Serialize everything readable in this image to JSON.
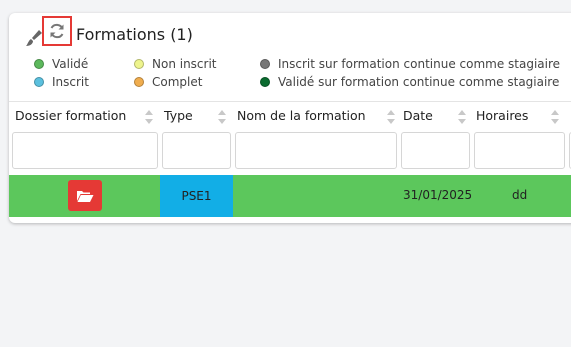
{
  "header": {
    "title": "Formations",
    "count": "(1)",
    "brush_icon": "brush-icon",
    "refresh_icon": "refresh-icon"
  },
  "legend": {
    "valide": "Validé",
    "non_inscrit": "Non inscrit",
    "inscrit_continue": "Inscrit sur formation continue comme stagiaire",
    "inscrit": "Inscrit",
    "complet": "Complet",
    "valide_continue": "Validé sur formation continue comme stagiaire"
  },
  "colors": {
    "valide": "#5cb85c",
    "non_inscrit": "#eef48d",
    "inscrit_continue": "#777777",
    "inscrit": "#5bc0de",
    "complet": "#f0ad4e",
    "valide_continue": "#0a6b2f",
    "row_bg": "#5cc75c",
    "type_bg": "#12aee6",
    "folder_btn": "#e53935"
  },
  "table": {
    "columns": [
      "Dossier formation",
      "Type",
      "Nom de la formation",
      "Date",
      "Horaires"
    ],
    "rows": [
      {
        "dossier_icon": "folder-open-icon",
        "type": "PSE1",
        "nom": "",
        "date": "31/01/2025",
        "horaires": "dd"
      }
    ]
  }
}
